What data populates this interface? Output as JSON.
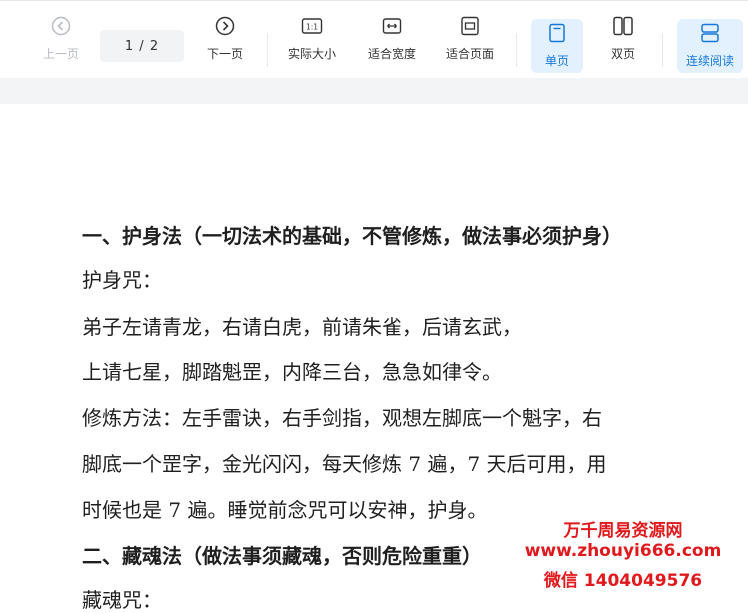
{
  "toolbar": {
    "prev_label": "上一页",
    "page_indicator": "1 / 2",
    "next_label": "下一页",
    "actual_size_label": "实际大小",
    "fit_width_label": "适合宽度",
    "fit_page_label": "适合页面",
    "single_page_label": "单页",
    "double_page_label": "双页",
    "continuous_label": "连续阅读",
    "actual_size_icon_text": "1:1",
    "accent_color": "#1677d9"
  },
  "document": {
    "lines": [
      "一、护身法（一切法术的基础，不管修炼，做法事必须护身）",
      "护身咒：",
      "弟子左请青龙，右请白虎，前请朱雀，后请玄武，",
      "上请七星，脚踏魁罡，内降三台，急急如律令。",
      "修炼方法：左手雷诀，右手剑指，观想左脚底一个魁字，右",
      "脚底一个罡字，金光闪闪，每天修炼 7 遍，7 天后可用，用",
      "时候也是 7 遍。睡觉前念咒可以安神，护身。",
      "二、藏魂法（做法事须藏魂，否则危险重重）",
      "藏魂咒："
    ]
  },
  "watermark": {
    "line1": "万千周易资源网",
    "line2": "www.zhouyi666.com",
    "line3": "微信 1404049576",
    "color": "#e0191d"
  }
}
